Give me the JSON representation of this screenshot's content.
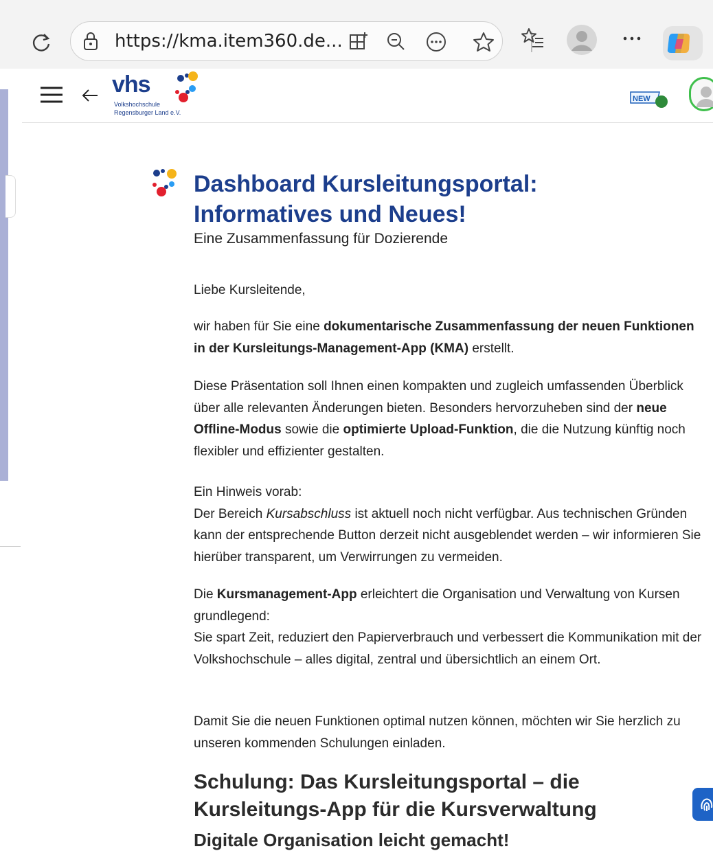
{
  "browser": {
    "url": "https://kma.item360.de...",
    "more_label": "⋯"
  },
  "header": {
    "logo_text": "vhs",
    "logo_sub_1": "Volkshochschule",
    "logo_sub_2": "Regensburger Land e.V.",
    "new_badge": "NEW"
  },
  "page": {
    "title_line1": "Dashboard Kursleitungsportal:",
    "title_line2": "Informatives und Neues!",
    "subtitle": "Eine Zusammenfassung für Dozierende",
    "greeting": "Liebe Kursleitende,",
    "p1_a": "wir haben für Sie eine ",
    "p1_b": "dokumentarische Zusammenfassung der neuen Funktionen in der Kursleitungs-Management-App (KMA)",
    "p1_c": " erstellt.",
    "p2_a": "Diese Präsentation soll Ihnen einen kompakten und zugleich umfassenden Überblick über alle relevanten Änderungen bieten. Besonders hervorzuheben sind der ",
    "p2_b": "neue Offline-Modus",
    "p2_c": " sowie die ",
    "p2_d": "optimierte Upload-Funktion",
    "p2_e": ", die die Nutzung künftig noch flexibler und effizienter gestalten.",
    "p3_a": "Ein Hinweis vorab:",
    "p3_b": "Der Bereich ",
    "p3_c": "Kursabschluss",
    "p3_d": " ist aktuell noch nicht verfügbar. Aus technischen Gründen kann der entsprechende Button derzeit nicht ausgeblendet werden – wir informieren Sie hierüber transparent, um Verwirrungen zu vermeiden.",
    "p4_a": "Die ",
    "p4_b": "Kursmanagement-App",
    "p4_c": " erleichtert die Organisation und Verwaltung von Kursen grundlegend:",
    "p4_d": "Sie spart Zeit, reduziert den Papierverbrauch und verbessert die Kommunikation mit der Volkshochschule – alles digital, zentral und übersichtlich an einem Ort.",
    "p5": "Damit Sie die neuen Funktionen optimal nutzen können, möchten wir Sie herzlich zu unseren kommenden Schulungen einladen.",
    "h2_line1": "Schulung: Das Kursleitungsportal – die",
    "h2_line2": "Kursleitungs-App für die Kursverwaltung",
    "h3": "Digitale Organisation leicht gemacht!"
  },
  "colors": {
    "brand_blue": "#1c3e8c",
    "accent_green": "#3fbf4c",
    "panel_lavender": "#aab0d6"
  }
}
